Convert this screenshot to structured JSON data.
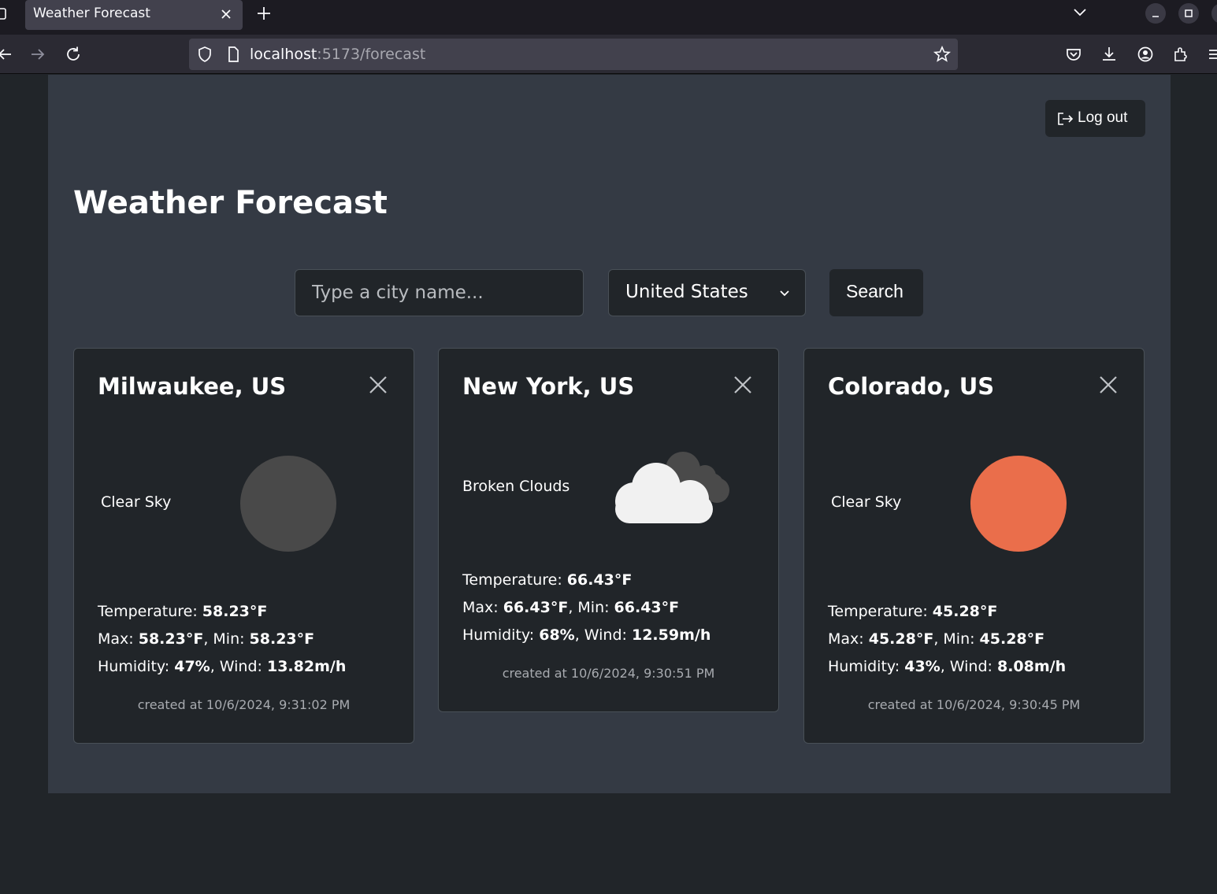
{
  "browser": {
    "tab_title": "Weather Forecast",
    "url_host": "localhost",
    "url_path": ":5173/forecast"
  },
  "header": {
    "logout_label": "Log out",
    "title": "Weather Forecast"
  },
  "search": {
    "placeholder": "Type a city name...",
    "country": "United States",
    "button_label": "Search"
  },
  "cards": [
    {
      "city": "Milwaukee, US",
      "description": "Clear Sky",
      "icon": "moon-icon",
      "icon_color": "#494949",
      "temp_label": "Temperature: ",
      "temp": "58.23°F",
      "max_label": "Max: ",
      "max": "58.23°F",
      "min_label": ", Min: ",
      "min": "58.23°F",
      "humidity_label": "Humidity: ",
      "humidity": "47%",
      "wind_label": ", Wind: ",
      "wind": "13.82m/h",
      "created": "created at 10/6/2024, 9:31:02 PM"
    },
    {
      "city": "New York, US",
      "description": "Broken Clouds",
      "icon": "cloud-icon",
      "icon_color": "#f1f1f1",
      "temp_label": "Temperature: ",
      "temp": "66.43°F",
      "max_label": "Max: ",
      "max": "66.43°F",
      "min_label": ", Min: ",
      "min": "66.43°F",
      "humidity_label": "Humidity: ",
      "humidity": "68%",
      "wind_label": ", Wind: ",
      "wind": "12.59m/h",
      "created": "created at 10/6/2024, 9:30:51 PM"
    },
    {
      "city": "Colorado, US",
      "description": "Clear Sky",
      "icon": "sun-icon",
      "icon_color": "#ea6e4b",
      "temp_label": "Temperature: ",
      "temp": "45.28°F",
      "max_label": "Max: ",
      "max": "45.28°F",
      "min_label": ", Min: ",
      "min": "45.28°F",
      "humidity_label": "Humidity: ",
      "humidity": "43%",
      "wind_label": ", Wind: ",
      "wind": "8.08m/h",
      "created": "created at 10/6/2024, 9:30:45 PM"
    }
  ]
}
